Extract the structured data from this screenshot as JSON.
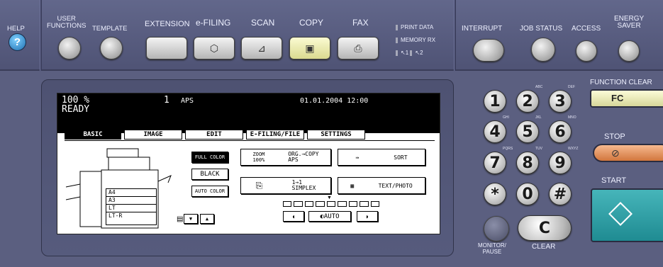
{
  "top": {
    "help": "HELP",
    "user_functions": "USER\nFUNCTIONS",
    "template": "TEMPLATE",
    "extension": "EXTENSION",
    "efiling": "e-FILING",
    "scan": "SCAN",
    "copy": "COPY",
    "fax": "FAX",
    "print_data": "PRINT DATA",
    "memory_rx": "MEMORY RX",
    "line1": "1",
    "line2": "2",
    "interrupt": "INTERRUPT",
    "job_status": "JOB STATUS",
    "access": "ACCESS",
    "energy_saver": "ENERGY\nSAVER"
  },
  "screen": {
    "copies_pct": "100 %",
    "count": "1",
    "aps": "APS",
    "datetime": "01.01.2004 12:00",
    "status": "READY",
    "tabs": [
      "BASIC",
      "IMAGE",
      "EDIT",
      "E-FILING/FILE",
      "SETTINGS"
    ],
    "color_buttons": [
      "FULL COLOR",
      "BLACK",
      "AUTO COLOR"
    ],
    "zoom": "ZOOM\n100%",
    "orig_copy": "ORG.→COPY\nAPS",
    "sort": "SORT",
    "simplex": "1→1\nSIMPLEX",
    "text_photo": "TEXT/PHOTO",
    "auto": "AUTO",
    "paper_sizes": [
      "A4",
      "A3",
      "LT",
      "LT-R"
    ]
  },
  "keypad": {
    "keys": [
      "1",
      "2",
      "3",
      "4",
      "5",
      "6",
      "7",
      "8",
      "9",
      "*",
      "0",
      "#"
    ],
    "letters": [
      "",
      "ABC",
      "DEF",
      "GHI",
      "JKL",
      "MNO",
      "PQRS",
      "TUV",
      "WXYZ"
    ],
    "monitor_pause": "MONITOR/\nPAUSE",
    "clear": "CLEAR",
    "clear_key": "C"
  },
  "right": {
    "function_clear": "FUNCTION CLEAR",
    "fc": "FC",
    "stop": "STOP",
    "start": "START"
  }
}
